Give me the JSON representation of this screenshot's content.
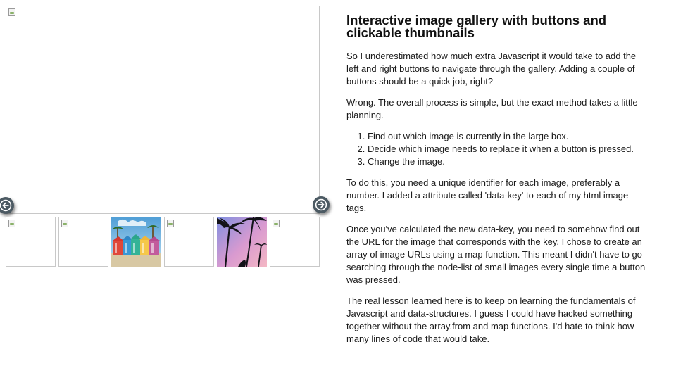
{
  "gallery": {
    "main_image_alt": "",
    "prev_button_icon": "arrow-left-icon",
    "next_button_icon": "arrow-right-icon",
    "thumbnails": [
      {
        "state": "broken"
      },
      {
        "state": "broken"
      },
      {
        "state": "photo",
        "subject": "colorful beach huts"
      },
      {
        "state": "broken"
      },
      {
        "state": "photo",
        "subject": "palm trees pink sky"
      },
      {
        "state": "broken"
      }
    ]
  },
  "article": {
    "title": "Interactive image gallery with buttons and clickable thumbnails",
    "p1": "So I underestimated how much extra Javascript it would take to add the left and right buttons to navigate through the gallery. Adding a couple of buttons should be a quick job, right?",
    "p2": "Wrong. The overall process is simple, but the exact method takes a little planning.",
    "steps": [
      "Find out which image is currently in the large box.",
      "Decide which image needs to replace it when a button is pressed.",
      "Change the image."
    ],
    "p3": "To do this, you need a unique identifier for each image, preferably a number. I added a attribute called 'data-key' to each of my html image tags.",
    "p4": "Once you've calculated the new data-key, you need to somehow find out the URL for the image that corresponds with the key. I chose to create an array of image URLs using a map function. This meant I didn't have to go searching through the node-list of small images every single time a button was pressed.",
    "p5": "The real lesson learned here is to keep on learning the fundamentals of Javascript and data-structures. I guess I could have hacked something together without the array.from and map functions. I'd hate to think how many lines of code that would take."
  },
  "colors": {
    "button_bg": "#4c5a63",
    "border": "#c8c8c8",
    "text": "#1a1a1a"
  }
}
